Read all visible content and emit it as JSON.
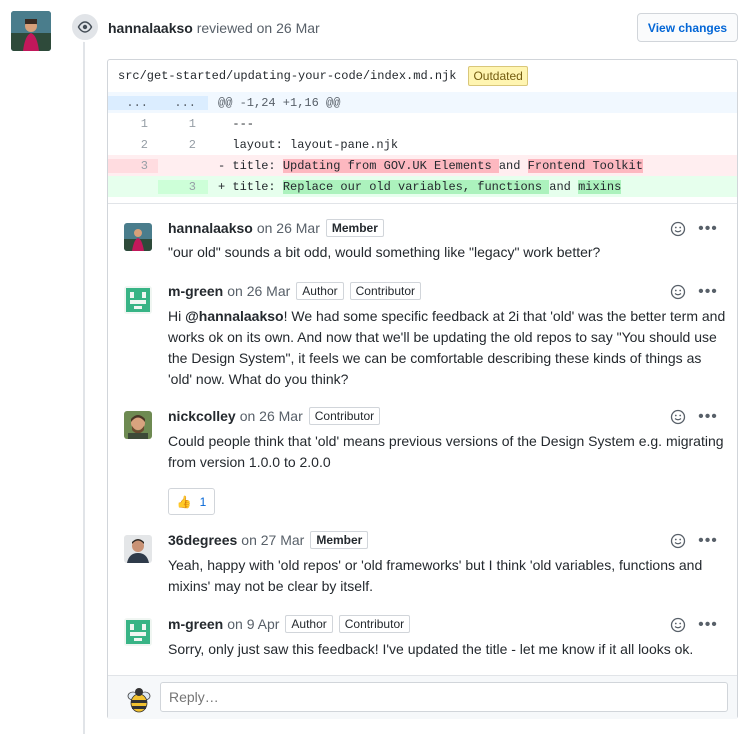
{
  "review": {
    "author": "hannalaakso",
    "action": "reviewed",
    "date": "on 26 Mar",
    "view_changes_label": "View changes"
  },
  "file": {
    "path": "src/get-started/updating-your-code/index.md.njk",
    "badge": "Outdated"
  },
  "diff": {
    "hunk_left": "...",
    "hunk_right": "...",
    "hunk_header": "@@ -1,24 +1,16 @@",
    "lines": [
      {
        "type": "context",
        "old": "1",
        "new": "1",
        "text": "  ---"
      },
      {
        "type": "context",
        "old": "2",
        "new": "2",
        "text": "  layout: layout-pane.njk"
      },
      {
        "type": "del",
        "old": "3",
        "new": "",
        "prefix": "- title: ",
        "seg1": "Updating from GOV.UK Elements ",
        "mid": "and ",
        "seg2": "Frontend Toolkit"
      },
      {
        "type": "add",
        "old": "",
        "new": "3",
        "prefix": "+ title: ",
        "seg1": "Replace our old variables, functions ",
        "mid": "and ",
        "seg2": "mixins"
      }
    ]
  },
  "comments": [
    {
      "author": "hannalaakso",
      "date": "on 26 Mar",
      "roles": [
        "Member"
      ],
      "body": "\"our old\" sounds a bit odd, would something like \"legacy\" work better?"
    },
    {
      "author": "m-green",
      "date": "on 26 Mar",
      "roles": [
        "Author",
        "Contributor"
      ],
      "body_prefix": "Hi ",
      "mention": "@hannalaakso",
      "body": "! We had some specific feedback at 2i that 'old' was the better term and works ok on its own. And now that we'll be updating the old repos to say \"You should use the Design System\", it feels we can be comfortable describing these kinds of things as 'old' now. What do you think?"
    },
    {
      "author": "nickcolley",
      "date": "on 26 Mar",
      "roles": [
        "Contributor"
      ],
      "body": "Could people think that 'old' means previous versions of the Design System e.g. migrating from version 1.0.0 to 2.0.0",
      "reaction": {
        "emoji": "👍",
        "count": "1"
      }
    },
    {
      "author": "36degrees",
      "date": "on 27 Mar",
      "roles": [
        "Member"
      ],
      "body": "Yeah, happy with 'old repos' or 'old frameworks' but I think 'old variables, functions and mixins' may not be clear by itself."
    },
    {
      "author": "m-green",
      "date": "on 9 Apr",
      "roles": [
        "Author",
        "Contributor"
      ],
      "body": "Sorry, only just saw this feedback! I've updated the title - let me know if it all looks ok."
    }
  ],
  "reply": {
    "placeholder": "Reply…"
  },
  "icons": {
    "review_event": "eye-icon",
    "reaction": "smiley-icon",
    "more": "kebab-horizontal-icon"
  },
  "colors": {
    "link": "#0366d6",
    "deleted_bg": "#ffeef0",
    "added_bg": "#e6ffed",
    "outdated_bg": "#fff5b1"
  }
}
